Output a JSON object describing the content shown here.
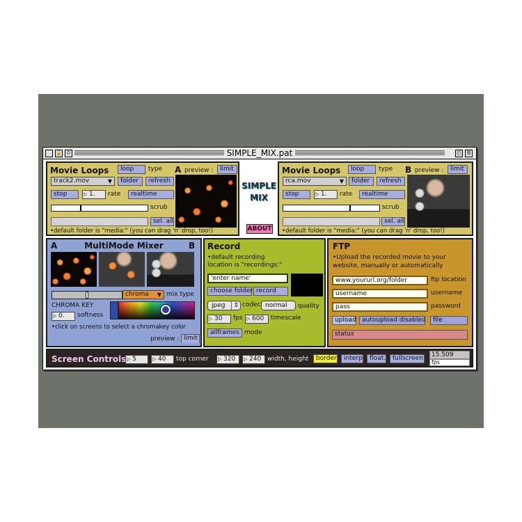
{
  "window": {
    "title": "SIMPLE_MIX.pat"
  },
  "logo": {
    "line1": "SIMPLE",
    "line2": "MIX",
    "about_button": "ABOUT"
  },
  "movie_loops_a": {
    "title": "Movie Loops",
    "channel": "A",
    "loop_button": "loop",
    "type_label": "type",
    "preview_label": "preview :",
    "limit_button": "limit",
    "file_menu": "track2.mov",
    "folder_button": "folder",
    "refresh_button": "refresh",
    "stop_button": "stop",
    "rate_value": "1.",
    "rate_label": "rate",
    "realtime_button": "realtime",
    "scrub_label": "scrub",
    "scrub_position": 0.3,
    "sel_all_button": "sel. all",
    "note": "•default folder is \"media:\" (you can drag 'n' drop, too!)"
  },
  "movie_loops_b": {
    "title": "Movie Loops",
    "channel": "B",
    "loop_button": "loop",
    "type_label": "type",
    "preview_label": "preview :",
    "limit_button": "limit",
    "file_menu": "rca.mov",
    "folder_button": "folder",
    "refresh_button": "refresh",
    "stop_button": "stop",
    "rate_value": "1.",
    "rate_label": "rate",
    "realtime_button": "realtime",
    "scrub_label": "scrub",
    "scrub_position": 0.7,
    "sel_all_button": "sel. all",
    "note": "•default folder is \"media:\" (you can drag 'n' drop, too!)"
  },
  "mixer": {
    "label_a": "A",
    "title": "MultiMode Mixer",
    "label_b": "B",
    "crossfade_position": 0.5,
    "mix_type_menu": "chroma",
    "mix_type_label": "mix type",
    "chroma_key_label": "CHROMA KEY",
    "softness_value": "0.",
    "softness_label": "softness",
    "note": "•click on screens to select a chromakey color",
    "preview_label": "preview :",
    "limit_button": "limit"
  },
  "record": {
    "title": "Record",
    "note_line1": "•default recording",
    "note_line2": "location is \"recordings:\"",
    "name_field": "'enter name'",
    "choose_folder_button": "choose folder",
    "record_button": "record",
    "codec_menu": "jpeg",
    "codec_label": "codec",
    "quality_menu": "normal",
    "quality_label": "quality",
    "fps_value": "30",
    "fps_label": "fps",
    "timescale_value": "600",
    "timescale_label": "timescale",
    "mode_button": "allframes",
    "mode_label": "mode"
  },
  "ftp": {
    "title": "FTP",
    "note_line1": "•Upload the recorded movie to your",
    "note_line2": "website, manually or automatically",
    "location_field": "www.yoururl.org/folder",
    "location_label": "ftp location",
    "username_field": "username",
    "username_label": "username",
    "password_field": "pass",
    "password_label": "password",
    "upload_button": "upload",
    "autoupload_button": "autoupload disabled",
    "file_button": "file",
    "status": "status"
  },
  "screen_controls": {
    "title": "Screen Controls",
    "x_value": "5",
    "y_value": "40",
    "top_corner_label": "top corner",
    "width_value": "320",
    "height_value": "240",
    "size_label": "width, height",
    "border_button": "border",
    "interp_button": "interp",
    "float_button": "float.",
    "fullscreen_button": "fullscreen",
    "fps_readout": "15.509",
    "fps_label": "fps"
  },
  "colors": {
    "backdrop": "#6f726b",
    "movie_panel": "#d4c76a",
    "mixer_panel": "#8fa2d4",
    "record_panel": "#a8bc2c",
    "ftp_panel": "#c8962c",
    "screen_panel": "#2a2422",
    "button": "#a7ade0",
    "about_button": "#f07ab8",
    "border_active": "#f5f020",
    "status": "#d88a8a"
  }
}
